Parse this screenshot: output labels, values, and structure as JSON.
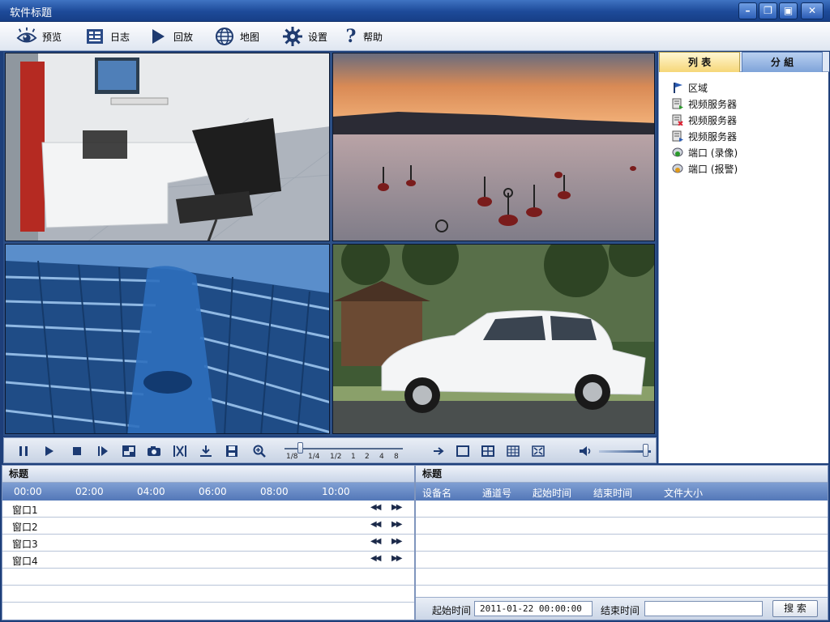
{
  "window": {
    "title": "软件标题",
    "buttons": [
      "minimize",
      "restore",
      "lock",
      "close"
    ]
  },
  "menu": [
    {
      "label": "预览",
      "icon": "eye-icon"
    },
    {
      "label": "日志",
      "icon": "log-icon"
    },
    {
      "label": "回放",
      "icon": "play-icon"
    },
    {
      "label": "地图",
      "icon": "globe-icon"
    },
    {
      "label": "设置",
      "icon": "gear-icon"
    },
    {
      "label": "帮助",
      "icon": "help-icon"
    }
  ],
  "right_panel": {
    "tabs": [
      "列 表",
      "分 組"
    ],
    "tree": [
      {
        "label": "区域",
        "icon": "flag-icon"
      },
      {
        "label": "视频服务器",
        "icon": "server-icon"
      },
      {
        "label": "视频服务器",
        "icon": "server-icon"
      },
      {
        "label": "视频服务器",
        "icon": "server-icon"
      },
      {
        "label": "端口 (录像)",
        "icon": "port-record-icon"
      },
      {
        "label": "端口 (报警)",
        "icon": "port-alarm-icon"
      }
    ]
  },
  "playback": {
    "speeds": [
      "1/8",
      "1/4",
      "1/2",
      "1",
      "2",
      "4",
      "8"
    ],
    "volume": 0.9
  },
  "timeline_panel": {
    "title": "标题",
    "times": [
      "00:00",
      "02:00",
      "04:00",
      "06:00",
      "08:00",
      "10:00"
    ],
    "rows": [
      "窗口1",
      "窗口2",
      "窗口3",
      "窗口4"
    ]
  },
  "records_panel": {
    "title": "标题",
    "columns": [
      "设备名",
      "通道号",
      "起始时间",
      "结束时间",
      "文件大小"
    ],
    "start_label": "起始时间",
    "start_value": "2011-01-22 00:00:00",
    "end_label": "结束时间",
    "end_value": "",
    "search_label": "搜 索"
  },
  "colors": {
    "titlebar": "#1d4a99",
    "header_blue": "#5377b8",
    "tab_active": "#f6d778"
  }
}
